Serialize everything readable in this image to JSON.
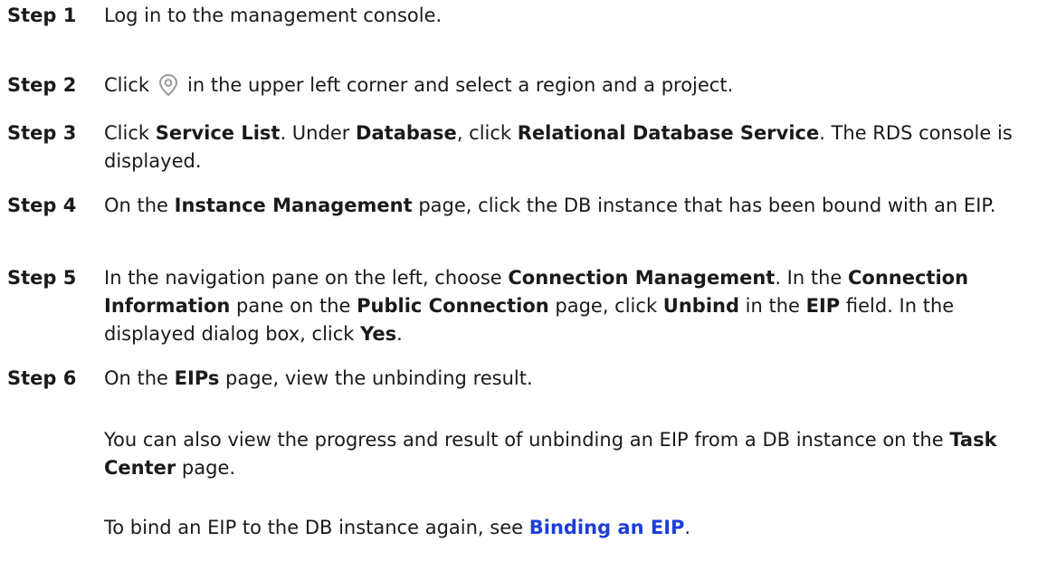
{
  "steps": [
    {
      "label": "Step 1",
      "segments": [
        "Log in to the management console."
      ]
    },
    {
      "label": "Step 2",
      "pre": "Click",
      "icon": "location-pin-icon",
      "post": "in the upper left corner and select a region and a project."
    },
    {
      "label": "Step 3",
      "segments": [
        "Click ",
        "Service List",
        ". Under ",
        "Database",
        ", click ",
        "Relational Database Service",
        ". The RDS console is displayed."
      ]
    },
    {
      "label": "Step 4",
      "segments": [
        "On the ",
        "Instance Management",
        " page, click the DB instance that has been bound with an EIP."
      ]
    },
    {
      "label": "Step 5",
      "segments": [
        "In the navigation pane on the left, choose ",
        "Connection Management",
        ". In the ",
        "Connection Information",
        " pane on the ",
        "Public Connection",
        " page, click ",
        "Unbind",
        " in the ",
        "EIP",
        " field. In the displayed dialog box, click ",
        "Yes",
        "."
      ]
    },
    {
      "label": "Step 6",
      "segments": [
        "On the ",
        "EIPs",
        " page, view the unbinding result."
      ]
    }
  ],
  "notes": [
    {
      "segments": [
        "You can also view the progress and result of unbinding an EIP from a DB instance on the ",
        "Task Center",
        " page."
      ]
    },
    {
      "segments": [
        "To bind an EIP to the DB instance again, see ",
        "Binding an EIP",
        "."
      ]
    }
  ],
  "colors": {
    "link": "#1c3fd9",
    "text": "#1a1a1a",
    "icon": "#9a9a9a"
  }
}
